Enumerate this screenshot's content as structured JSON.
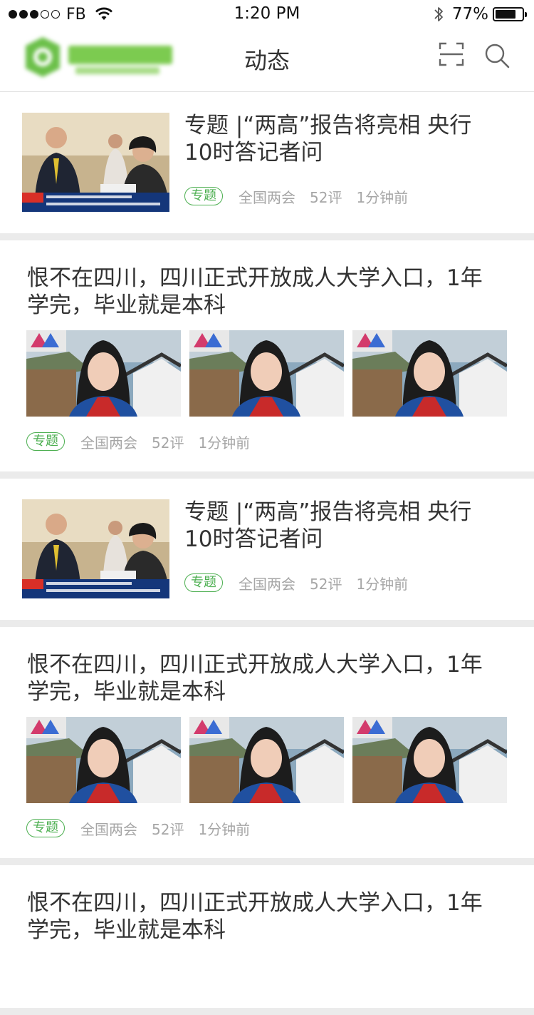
{
  "status_bar": {
    "carrier": "FB",
    "time": "1:20 PM",
    "battery_percent": "77%",
    "battery_level": 0.77,
    "signal_bars_filled": 3,
    "signal_bars_total": 5
  },
  "nav": {
    "title": "动态",
    "icons": [
      "scan-icon",
      "search-icon"
    ],
    "accent_color": "#4caf50"
  },
  "feed": [
    {
      "layout": "small-thumbnail",
      "title_line1": "专题 |“两高”报告将亮相 央行",
      "title_line2": "10时答记者问",
      "tag": "专题",
      "source": "全国两会",
      "comments": "52评",
      "time": "1分钟前"
    },
    {
      "layout": "three-photos",
      "title_line1": "恨不在四川，四川正式开放成人大学入口，1年",
      "title_line2": "学完，毕业就是本科",
      "tag": "专题",
      "source": "全国两会",
      "comments": "52评",
      "time": "1分钟前"
    },
    {
      "layout": "small-thumbnail",
      "title_line1": "专题 |“两高”报告将亮相 央行",
      "title_line2": "10时答记者问",
      "tag": "专题",
      "source": "全国两会",
      "comments": "52评",
      "time": "1分钟前"
    },
    {
      "layout": "three-photos",
      "title_line1": "恨不在四川，四川正式开放成人大学入口，1年",
      "title_line2": "学完，毕业就是本科",
      "tag": "专题",
      "source": "全国两会",
      "comments": "52评",
      "time": "1分钟前"
    },
    {
      "layout": "text-partial",
      "title_line1": "恨不在四川，四川正式开放成人大学入口，1年",
      "title_line2": "学完，毕业就是本科"
    }
  ]
}
